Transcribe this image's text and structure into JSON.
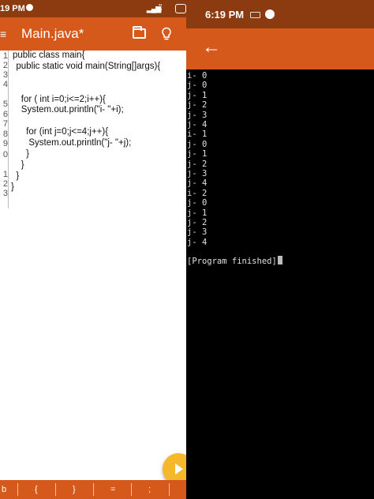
{
  "editor_window": {
    "status_bar": {
      "time": "19 PM"
    },
    "app_bar": {
      "menu_glyph": "≡",
      "title": "Main.java*",
      "icons": [
        "folder-icon",
        "lightbulb-icon"
      ]
    },
    "line_numbers": [
      "1",
      "2",
      "3",
      "4",
      "5",
      "6",
      "7",
      "8",
      "9",
      "0",
      "1",
      "2",
      "3"
    ],
    "code_lines": [
      "public class main{",
      "  public static void main(String[]args){",
      "",
      "",
      "    for ( int i=0;i<=2;i++){",
      "    System.out.println(\"i- \"+i);",
      "",
      "      for (int j=0;j<=4;j++){",
      "       System.out.println(\"j- \"+j);",
      "      }",
      "    }",
      "  }",
      "}"
    ],
    "symbol_bar": [
      "b",
      "{",
      "}",
      "=",
      ";"
    ]
  },
  "terminal_window": {
    "status_bar": {
      "time": "6:19 PM"
    },
    "output_lines": [
      "i- 0",
      "j- 0",
      "j- 1",
      "j- 2",
      "j- 3",
      "j- 4",
      "i- 1",
      "j- 0",
      "j- 1",
      "j- 2",
      "j- 3",
      "j- 4",
      "i- 2",
      "j- 0",
      "j- 1",
      "j- 2",
      "j- 3",
      "j- 4"
    ],
    "finished_message": "[Program finished]"
  },
  "colors": {
    "status_bar": "#8c3a10",
    "app_bar": "#d4591a",
    "fab": "#f5b82a",
    "terminal_bg": "#000000"
  }
}
